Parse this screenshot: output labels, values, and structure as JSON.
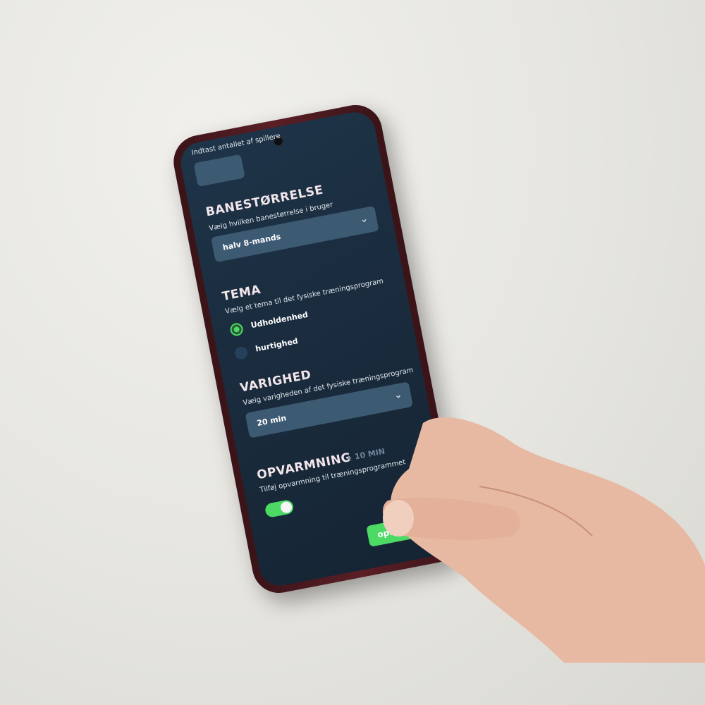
{
  "players": {
    "label": "Indtast antallet af spillere",
    "value": ""
  },
  "field_size": {
    "heading": "BANESTØRRELSE",
    "description": "Vælg hvilken banestørrelse i bruger",
    "selected": "halv 8-mands",
    "icon": "chevron-down-icon"
  },
  "theme": {
    "heading": "TEMA",
    "description": "Vælg et tema til det fysiske træningsprogram",
    "options": [
      {
        "label": "Udholdenhed",
        "selected": true
      },
      {
        "label": "hurtighed",
        "selected": false
      }
    ]
  },
  "duration": {
    "heading": "VARIGHED",
    "description": "Vælg varigheden af det fysiske træningsprogram",
    "selected": "20 min",
    "icon": "chevron-down-icon"
  },
  "warmup": {
    "heading": "OPVARMNING",
    "extra": "+ 10 MIN",
    "description": "Tilføj opvarmning til træningsprogrammet",
    "enabled": true
  },
  "submit": {
    "label": "opret"
  },
  "colors": {
    "accent": "#4cd964",
    "screen_bg": "#1a2c3e",
    "field_bg": "#3d5a73",
    "heading": "#f3e6ea"
  }
}
